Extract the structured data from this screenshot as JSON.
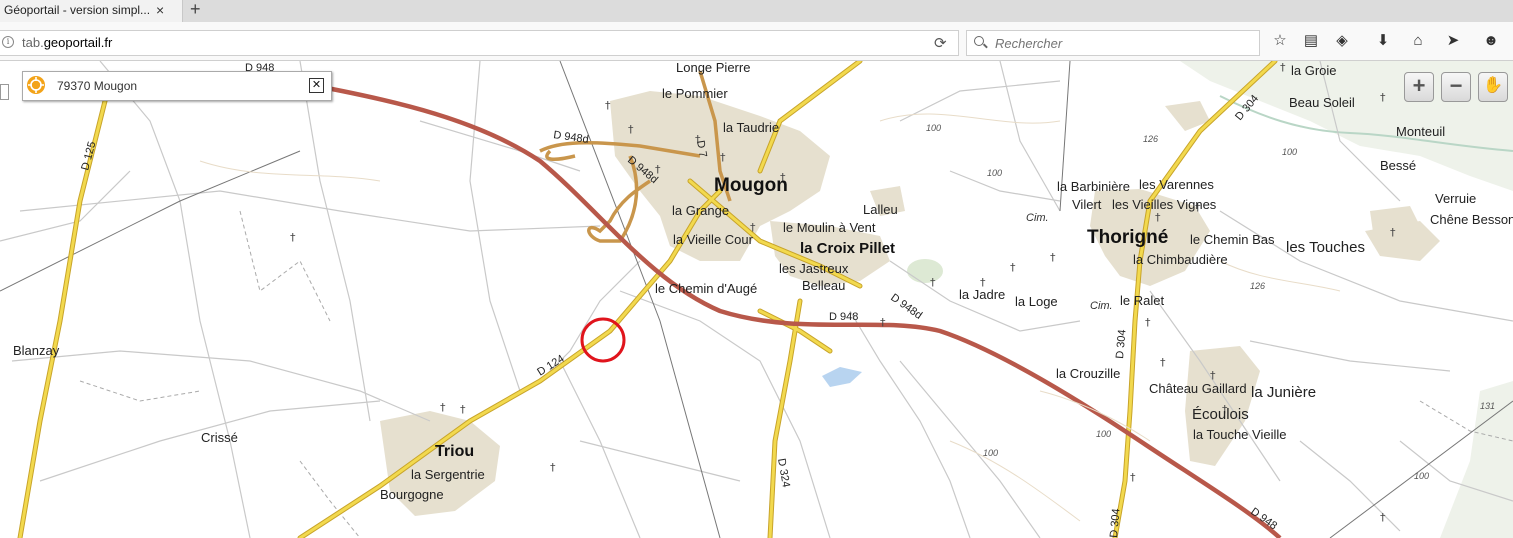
{
  "browser": {
    "tab_title": "Géoportail - version simpl...",
    "tab_close": "×",
    "new_tab": "+",
    "info": "i",
    "url_prefix": "tab.",
    "url_domain": "geoportail.fr",
    "reload": "⟳",
    "search_placeholder": "Rechercher",
    "toolbar_icons": [
      "star-icon",
      "reading-list-icon",
      "pocket-icon",
      "download-icon",
      "home-icon",
      "send-icon",
      "chat-icon"
    ],
    "toolbar_glyphs": [
      "☆",
      "▤",
      "◈",
      "⬇",
      "⌂",
      "➤",
      "☻"
    ]
  },
  "search_result": {
    "text": "79370 Mougon",
    "close": "✕"
  },
  "map_controls": {
    "zoom_in": "+",
    "zoom_out": "−",
    "pan": "✋"
  },
  "map": {
    "towns": [
      "Mougon",
      "Thorigné",
      "Triou",
      "la Croix Pillet"
    ],
    "places": [
      "Longe Pierre",
      "le Pommier",
      "la Taudrie",
      "la Grange",
      "la Vieille Cour",
      "le Moulin à Vent",
      "les Jastreux",
      "Belleau",
      "Lalleu",
      "le Chemin d'Augé",
      "la Barbinière",
      "les Varennes",
      "Vilert",
      "les Vieilles Vignes",
      "le Chemin Bas",
      "la Chimbaudière",
      "les Touches",
      "la Jadre",
      "la Loge",
      "le Ralet",
      "la Crouzille",
      "Château Gaillard",
      "la Junière",
      "Écoulois",
      "la Touche Vieille",
      "Blanzay",
      "Crissé",
      "la Sergentrie",
      "Bourgogne",
      "la Groie",
      "Beau Soleil",
      "Monteuil",
      "Bessé",
      "Verruie",
      "Chêne Besson"
    ],
    "roads": [
      "D 948",
      "D 948d",
      "D 948d",
      "D 125",
      "D 124",
      "D 324",
      "D 304",
      "D 304",
      "D 304",
      "D 948",
      "D 948d",
      "D 948",
      "D 7"
    ],
    "contours": [
      "100",
      "100",
      "100",
      "100",
      "100",
      "126",
      "126",
      "131",
      "100"
    ],
    "misc": [
      "Cim.",
      "Cim."
    ]
  },
  "colors": {
    "motorway": "#b8584a",
    "main_road": "#f0d44a",
    "secondary_road": "#c9964c",
    "town_area": "#e6e0cf",
    "marker_circle": "#e0141c"
  }
}
